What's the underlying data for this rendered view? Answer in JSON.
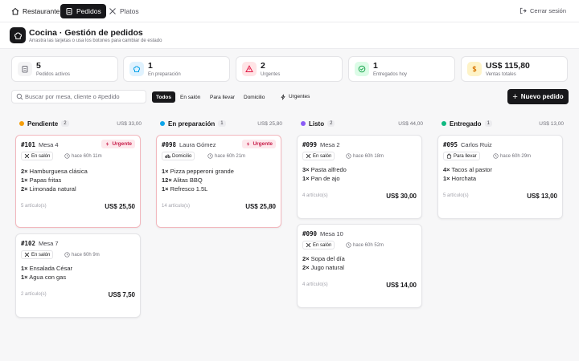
{
  "nav": {
    "restaurant": "Restaurante",
    "orders": "Pedidos",
    "dishes": "Platos",
    "logout": "Cerrar sesión"
  },
  "header": {
    "title": "Cocina · Gestión de pedidos",
    "subtitle": "Arrastra las tarjetas o usa los botones para cambiar de estado"
  },
  "stats": [
    {
      "value": "5",
      "label": "Pedidos activos",
      "icon": "clipboard-icon",
      "color": "#71717a",
      "bg": "#f4f4f5"
    },
    {
      "value": "1",
      "label": "En preparación",
      "icon": "chef-hat-icon",
      "color": "#0ea5e9",
      "bg": "#e0f2fe"
    },
    {
      "value": "2",
      "label": "Urgentes",
      "icon": "warning-icon",
      "color": "#e11d48",
      "bg": "#ffe4e6"
    },
    {
      "value": "1",
      "label": "Entregados hoy",
      "icon": "check-circle-icon",
      "color": "#16a34a",
      "bg": "#dcfce7"
    },
    {
      "value": "US$ 115,80",
      "label": "Ventas totales",
      "icon": "dollar-icon",
      "color": "#d97706",
      "bg": "#fef3c7"
    }
  ],
  "search": {
    "placeholder": "Buscar por mesa, cliente o #pedido"
  },
  "filters": {
    "all": "Todos",
    "dine_in": "En salón",
    "takeaway": "Para llevar",
    "delivery": "Domicilio",
    "urgent": "Urgentes"
  },
  "new_order": "Nuevo pedido",
  "columns": [
    {
      "name": "Pendiente",
      "count": "2",
      "total": "US$ 33,00",
      "color": "#f59e0b"
    },
    {
      "name": "En preparación",
      "count": "1",
      "total": "US$ 25,80",
      "color": "#0ea5e9"
    },
    {
      "name": "Listo",
      "count": "2",
      "total": "US$ 44,00",
      "color": "#8b5cf6"
    },
    {
      "name": "Entregado",
      "count": "1",
      "total": "US$ 13,00",
      "color": "#10b981"
    }
  ],
  "orders": [
    {
      "id": "#101",
      "name": "Mesa 4",
      "urgent": "Urgente",
      "type": "En salón",
      "time": "hace 60h 11m",
      "lines": [
        {
          "q": "2×",
          "t": "Hamburguesa clásica"
        },
        {
          "q": "1×",
          "t": "Papas fritas"
        },
        {
          "q": "2×",
          "t": "Limonada natural"
        }
      ],
      "count": "5 artículo(s)",
      "total": "US$ 25,50"
    },
    {
      "id": "#102",
      "name": "Mesa 7",
      "type": "En salón",
      "time": "hace 60h 9m",
      "lines": [
        {
          "q": "1×",
          "t": "Ensalada César"
        },
        {
          "q": "1×",
          "t": "Agua con gas"
        }
      ],
      "count": "2 artículo(s)",
      "total": "US$ 7,50"
    },
    {
      "id": "#098",
      "name": "Laura Gómez",
      "urgent": "Urgente",
      "type": "Domicilio",
      "time": "hace 60h 21m",
      "lines": [
        {
          "q": "1×",
          "t": "Pizza pepperoni grande"
        },
        {
          "q": "12×",
          "t": "Alitas BBQ"
        },
        {
          "q": "1×",
          "t": "Refresco 1.5L"
        }
      ],
      "count": "14 artículo(s)",
      "total": "US$ 25,80"
    },
    {
      "id": "#099",
      "name": "Mesa 2",
      "type": "En salón",
      "time": "hace 60h 18m",
      "lines": [
        {
          "q": "3×",
          "t": "Pasta alfredo"
        },
        {
          "q": "1×",
          "t": "Pan de ajo"
        }
      ],
      "count": "4 artículo(s)",
      "total": "US$ 30,00"
    },
    {
      "id": "#090",
      "name": "Mesa 10",
      "type": "En salón",
      "time": "hace 60h 52m",
      "lines": [
        {
          "q": "2×",
          "t": "Sopa del día"
        },
        {
          "q": "2×",
          "t": "Jugo natural"
        }
      ],
      "count": "4 artículo(s)",
      "total": "US$ 14,00"
    },
    {
      "id": "#095",
      "name": "Carlos Ruiz",
      "type": "Para llevar",
      "time": "hace 60h 29m",
      "lines": [
        {
          "q": "4×",
          "t": "Tacos al pastor"
        },
        {
          "q": "1×",
          "t": "Horchata"
        }
      ],
      "count": "5 artículo(s)",
      "total": "US$ 13,00"
    }
  ]
}
